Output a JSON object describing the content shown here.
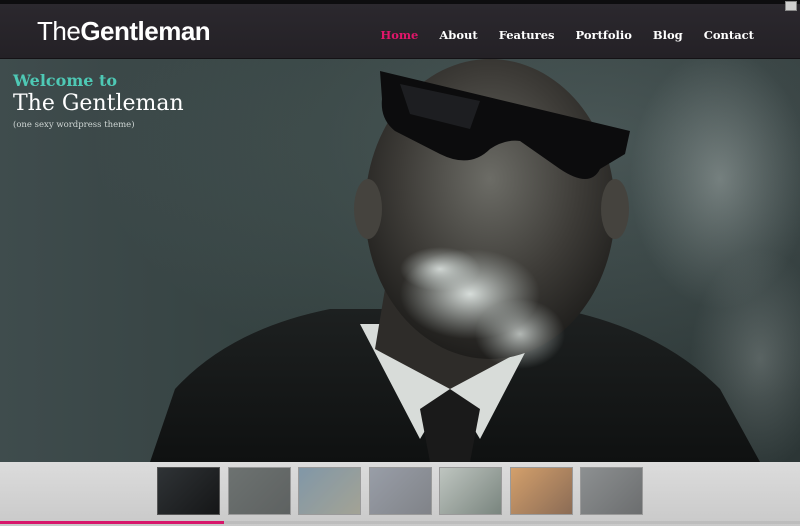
{
  "header": {
    "logo_light": "The",
    "logo_bold": "Gentleman",
    "nav": [
      {
        "label": "Home",
        "active": true
      },
      {
        "label": "About",
        "active": false
      },
      {
        "label": "Features",
        "active": false
      },
      {
        "label": "Portfolio",
        "active": false
      },
      {
        "label": "Blog",
        "active": false
      },
      {
        "label": "Contact",
        "active": false
      }
    ]
  },
  "hero": {
    "welcome": "Welcome to",
    "title": "The Gentleman",
    "subtitle": "(one sexy wordpress theme)"
  },
  "slider": {
    "thumbnails": [
      {
        "subject": "man in sunglasses",
        "selected": true,
        "tone": [
          "#2f3336",
          "#151617"
        ]
      },
      {
        "subject": "dark street scene",
        "selected": false,
        "tone": [
          "#3c4442",
          "#252b2a"
        ]
      },
      {
        "subject": "crowd of people",
        "selected": false,
        "tone": [
          "#5b7d96",
          "#8f8f7a"
        ]
      },
      {
        "subject": "dancers",
        "selected": false,
        "tone": [
          "#7f8796",
          "#5a5e66"
        ]
      },
      {
        "subject": "figure in doorway",
        "selected": false,
        "tone": [
          "#b9c3bb",
          "#4f6157"
        ]
      },
      {
        "subject": "arched hallway",
        "selected": false,
        "tone": [
          "#d98a3a",
          "#6a3a18"
        ]
      },
      {
        "subject": "smoke portrait",
        "selected": false,
        "tone": [
          "#6d7274",
          "#3a3d3f"
        ]
      }
    ],
    "progress": 0.28
  },
  "colors": {
    "accent": "#e0166a",
    "welcome_teal": "#4ec9b5"
  }
}
